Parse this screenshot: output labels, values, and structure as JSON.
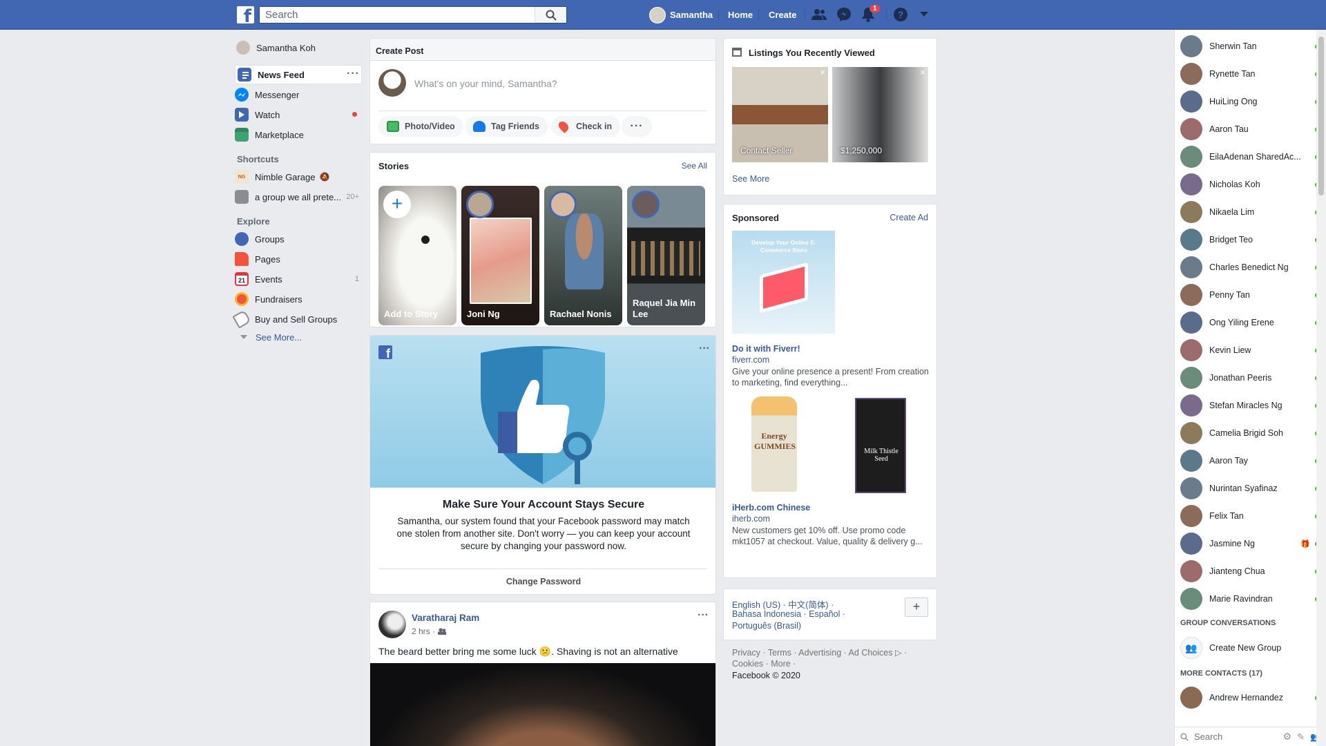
{
  "topbar": {
    "search_placeholder": "Search",
    "profile_name": "Samantha",
    "home": "Home",
    "create": "Create",
    "notif_count": "1"
  },
  "leftnav": {
    "profile": "Samantha Koh",
    "items": [
      {
        "label": "News Feed",
        "icon": "news-feed-icon"
      },
      {
        "label": "Messenger",
        "icon": "messenger-icon"
      },
      {
        "label": "Watch",
        "icon": "watch-icon"
      },
      {
        "label": "Marketplace",
        "icon": "marketplace-icon"
      }
    ],
    "shortcuts_heading": "Shortcuts",
    "shortcuts": [
      {
        "label": "Nimble Garage"
      },
      {
        "label": "a group we all prete...",
        "badge": "20+"
      }
    ],
    "explore_heading": "Explore",
    "explore": [
      {
        "label": "Groups",
        "icon": "groups-icon"
      },
      {
        "label": "Pages",
        "icon": "pages-icon"
      },
      {
        "label": "Events",
        "icon": "events-icon",
        "badge": "1"
      },
      {
        "label": "Fundraisers",
        "icon": "fundraisers-icon"
      },
      {
        "label": "Buy and Sell Groups",
        "icon": "buy-sell-icon"
      }
    ],
    "see_more": "See More..."
  },
  "create_post": {
    "title": "Create Post",
    "placeholder": "What's on your mind, Samantha?",
    "actions": [
      "Photo/Video",
      "Tag Friends",
      "Check in"
    ]
  },
  "stories": {
    "title": "Stories",
    "see_all": "See All",
    "items": [
      "Add to Story",
      "Joni Ng",
      "Rachael Nonis",
      "Raquel Jia Min Lee"
    ]
  },
  "security": {
    "title": "Make Sure Your Account Stays Secure",
    "body": "Samantha, our system found that your Facebook password may match one stolen from another site. Don't worry — you can keep your account secure by changing your password now.",
    "button": "Change Password"
  },
  "post": {
    "author": "Varatharaj Ram",
    "time": "2 hrs ·",
    "text": "The beard better bring me some luck 😕. Shaving is not an alternative"
  },
  "listings": {
    "title": "Listings You Recently Viewed",
    "items": [
      {
        "caption": "Contact Seller"
      },
      {
        "caption": "$1,250,000"
      }
    ],
    "see_more": "See More"
  },
  "sponsored": {
    "title": "Sponsored",
    "create_ad": "Create Ad",
    "ad_image_text": "Develop Your Online E-Commerce Store",
    "ads": [
      {
        "title": "Do it with Fiverr!",
        "domain": "fiverr.com",
        "desc": "Give your online presence a present! From creation to marketing, find everything..."
      },
      {
        "title": "iHerb.com Chinese",
        "domain": "iherb.com",
        "desc": "New customers get 10% off. Use promo code mkt1057 at checkout. Value, quality & delivery g..."
      }
    ],
    "product1_label": "Energy GUMMIES",
    "product2_label": "Milk Thistle Seed"
  },
  "languages": {
    "line1": "English (US) · 中文(简体) ·",
    "line2": "Bahasa Indonesia · Español ·",
    "line3": "Português (Brasil)"
  },
  "footer": {
    "line1": "Privacy · Terms · Advertising · Ad Choices ▷ ·",
    "line2": "Cookies · More ·",
    "line3": "Facebook © 2020"
  },
  "chat": {
    "contacts": [
      "Sherwin Tan",
      "Rynette Tan",
      "HuiLing Ong",
      "Aaron Tau",
      "EilaAdenan SharedAc...",
      "Nicholas Koh",
      "Nikaela Lim",
      "Bridget Teo",
      "Charles Benedict Ng",
      "Penny Tan",
      "Ong Yiling Erene",
      "Kevin Liew",
      "Jonathan Peeris",
      "Stefan Miracles Ng",
      "Camelia Brigid Soh",
      "Aaron Tay",
      "Nurintan Syafinaz",
      "Felix Tan",
      "Jasmine Ng",
      "Jianteng Chua",
      "Marie Ravindran"
    ],
    "group_heading": "GROUP CONVERSATIONS",
    "create_group": "Create New Group",
    "more_heading": "MORE CONTACTS (17)",
    "more_contacts": [
      "Andrew Hernandez"
    ],
    "search_placeholder": "Search"
  },
  "colors": {
    "brand": "#4267b2",
    "online": "#42b72a",
    "link": "#385898"
  }
}
